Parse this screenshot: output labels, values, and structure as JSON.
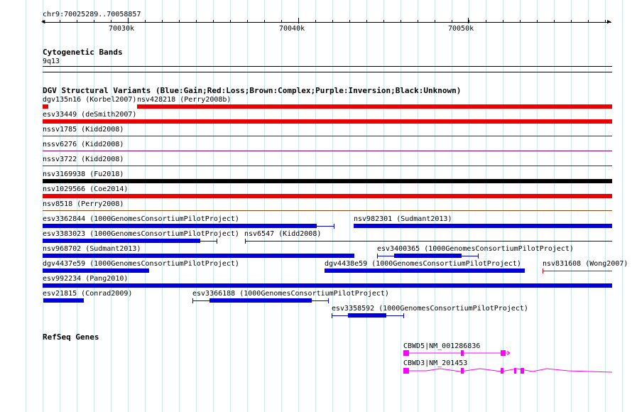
{
  "position": "chr9:70025289..70058857",
  "ruler": {
    "labels": [
      "70030k",
      "70040k",
      "70050k"
    ]
  },
  "cytoband": {
    "title": "Cytogenetic Bands",
    "band": "9q13"
  },
  "dgv": {
    "title": "DGV Structural Variants (Blue:Gain;Red:Loss;Brown:Complex;Purple:Inversion;Black:Unknown)",
    "labels": {
      "dgv135n16": "dgv135n16 (Korbel2007)",
      "nsv428218": "nsv428218 (Perry2008b)",
      "esv33449": "esv33449 (deSmith2007)",
      "nssv1785": "nssv1785 (Kidd2008)",
      "nssv6276": "nssv6276 (Kidd2008)",
      "nssv3722": "nssv3722 (Kidd2008)",
      "nsv3169938": "nsv3169938 (Fu2018)",
      "nsv1029566": "nsv1029566 (Coe2014)",
      "nsv8518": "nsv8518 (Perry2008)",
      "esv3362844": "esv3362844 (1000GenomesConsortiumPilotProject)",
      "nsv982301": "nsv982301 (Sudmant2013)",
      "esv3383023": "esv3383023 (1000GenomesConsortiumPilotProject)",
      "nsv6547": "nsv6547 (Kidd2008)",
      "nsv968702": "nsv968702 (Sudmant2013)",
      "esv3400365": "esv3400365 (1000GenomesConsortiumPilotProject)",
      "dgv4437e59": "dgv4437e59 (1000GenomesConsortiumPilotProject)",
      "dgv4438e59": "dgv4438e59 (1000GenomesConsortiumPilotProject)",
      "nsv831608": "nsv831608 (Wong2007)",
      "esv992234": "esv992234 (Pang2010)",
      "esv21815": "esv21815 (Conrad2009)",
      "esv3366188": "esv3366188 (1000GenomesConsortiumPilotProject)",
      "esv3358592": "esv3358592 (1000GenomesConsortiumPilotProject)"
    }
  },
  "refseq": {
    "title": "RefSeq Genes",
    "genes": [
      "CBWD5|NM_001286836",
      "CBWD3|NM_201453"
    ]
  },
  "colors": {
    "gain": "#0000dd",
    "loss": "#ee0000",
    "complex": "#8b4513",
    "inversion": "#800080",
    "unknown": "#000000",
    "gene": "#ff00ff",
    "grid": "#c6e6f1"
  }
}
